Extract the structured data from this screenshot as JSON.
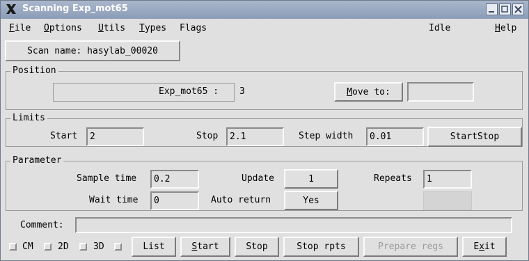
{
  "window": {
    "title": "Scanning Exp_mot65"
  },
  "menubar": {
    "file": "File",
    "options": "Options",
    "utils": "Utils",
    "types": "Types",
    "flags": "Flags",
    "status": "Idle",
    "help": "Help"
  },
  "scan_name": "Scan name: hasylab_00020",
  "position": {
    "title": "Position",
    "motor_label": "Exp_mot65 :",
    "value": "3",
    "move_to_label": "Move to:",
    "move_to_value": ""
  },
  "limits": {
    "title": "Limits",
    "start_label": "Start",
    "start_value": "2",
    "stop_label": "Stop",
    "stop_value": "2.1",
    "step_width_label": "Step width",
    "step_width_value": "0.01",
    "startstop_button": "StartStop"
  },
  "parameter": {
    "title": "Parameter",
    "sample_time_label": "Sample time",
    "sample_time_value": "0.2",
    "update_label": "Update",
    "update_value": "1",
    "repeats_label": "Repeats",
    "repeats_value": "1",
    "wait_time_label": "Wait time",
    "wait_time_value": "0",
    "auto_return_label": "Auto return",
    "auto_return_value": "Yes"
  },
  "comment": {
    "label": "Comment:",
    "value": ""
  },
  "bottom": {
    "cm": "CM",
    "d2": "2D",
    "d3": "3D",
    "list": "List",
    "start": "Start",
    "stop": "Stop",
    "stop_rpts": "Stop rpts",
    "prepare_regs": "Prepare regs",
    "exit": "Exit"
  }
}
